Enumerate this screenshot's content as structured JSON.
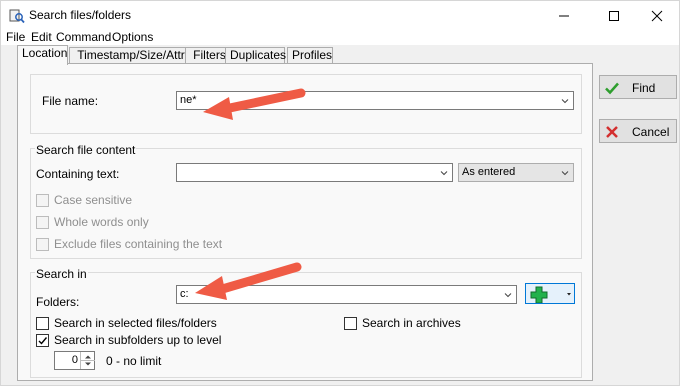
{
  "window": {
    "title": "Search files/folders"
  },
  "menu": [
    "File",
    "Edit",
    "Command",
    "Options"
  ],
  "tabs": [
    "Location",
    "Timestamp/Size/Attr",
    "Filters",
    "Duplicates",
    "Profiles"
  ],
  "location": {
    "file_name_label": "File name:",
    "file_name_value": "ne*",
    "search_file_content_group": "Search file content",
    "containing_text_label": "Containing text:",
    "containing_text_value": "",
    "match_mode_value": "As entered",
    "case_sensitive": "Case sensitive",
    "whole_words": "Whole words only",
    "exclude_files": "Exclude files containing the text",
    "search_in_group": "Search in",
    "folders_label": "Folders:",
    "folders_value": "c:",
    "search_selected": "Search in selected files/folders",
    "search_archives": "Search in archives",
    "search_subfolders": "Search in subfolders up to level",
    "level_value": "0",
    "level_hint": "0 - no limit"
  },
  "buttons": {
    "find": "Find",
    "cancel": "Cancel"
  },
  "colors": {
    "arrow": "#ef5b45",
    "find_check": "#2e9e2e",
    "cancel_x": "#d32f2f",
    "add_plus": "#22b14c"
  }
}
